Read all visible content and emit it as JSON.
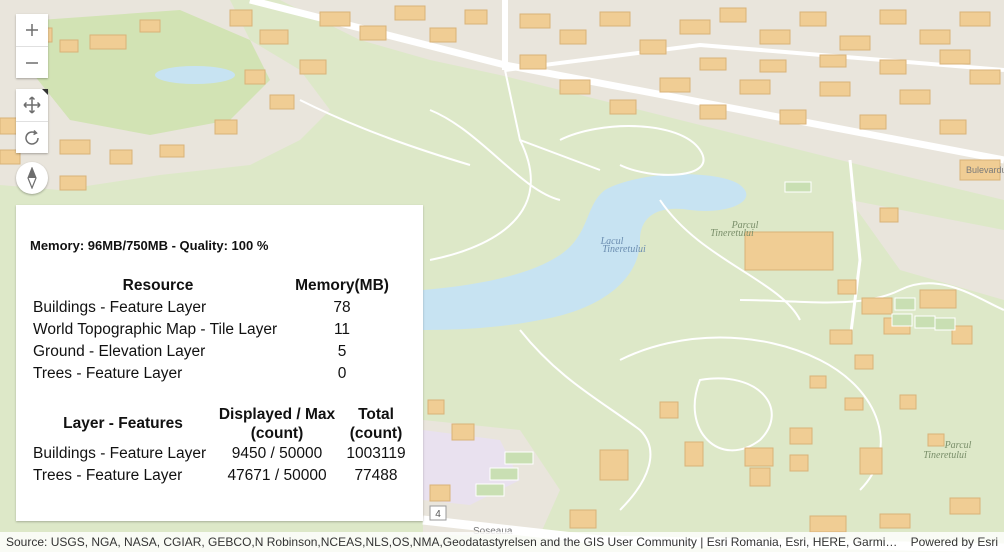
{
  "map": {
    "labels": {
      "lake": [
        "Lacul",
        "Tineretului"
      ],
      "park_upper": [
        "Parcul",
        "Tineretului"
      ],
      "park_lower": [
        "Parcul",
        "Tineretului"
      ],
      "road_number": "4",
      "street_top_right": "Bulevardul",
      "street_bottom": "Soseaua"
    },
    "colors": {
      "park": "#dbe7c4",
      "lake": "#c7e3f2",
      "buildings": "#f2cf97",
      "roads": "#ffffff"
    }
  },
  "controls": {
    "zoom_in_icon": "plus-icon",
    "zoom_out_icon": "minus-icon",
    "pan_icon": "pan-icon",
    "rotate_icon": "rotate-icon",
    "compass_icon": "compass-icon"
  },
  "panel": {
    "summary": "Memory: 96MB/750MB - Quality: 100 %",
    "resource_table": {
      "headers": [
        "Resource",
        "Memory(MB)"
      ],
      "rows": [
        {
          "name": "Buildings - Feature Layer",
          "memory": "78"
        },
        {
          "name": "World Topographic Map - Tile Layer",
          "memory": "11"
        },
        {
          "name": "Ground - Elevation Layer",
          "memory": "5"
        },
        {
          "name": "Trees - Feature Layer",
          "memory": "0"
        }
      ]
    },
    "features_table": {
      "headers": [
        "Layer - Features",
        "Displayed / Max",
        "(count)",
        "Total",
        "(count)"
      ],
      "rows": [
        {
          "name": "Buildings - Feature Layer",
          "displayed": "9450 / 50000",
          "total": "1003119"
        },
        {
          "name": "Trees - Feature Layer",
          "displayed": "47671 / 50000",
          "total": "77488"
        }
      ]
    }
  },
  "attribution": {
    "source": "Source: USGS, NGA, NASA, CGIAR, GEBCO,N Robinson,NCEAS,NLS,OS,NMA,Geodatastyrelsen and the GIS User Community | Esri Romania, Esri, HERE, Garmin, I...",
    "powered": "Powered by Esri"
  }
}
